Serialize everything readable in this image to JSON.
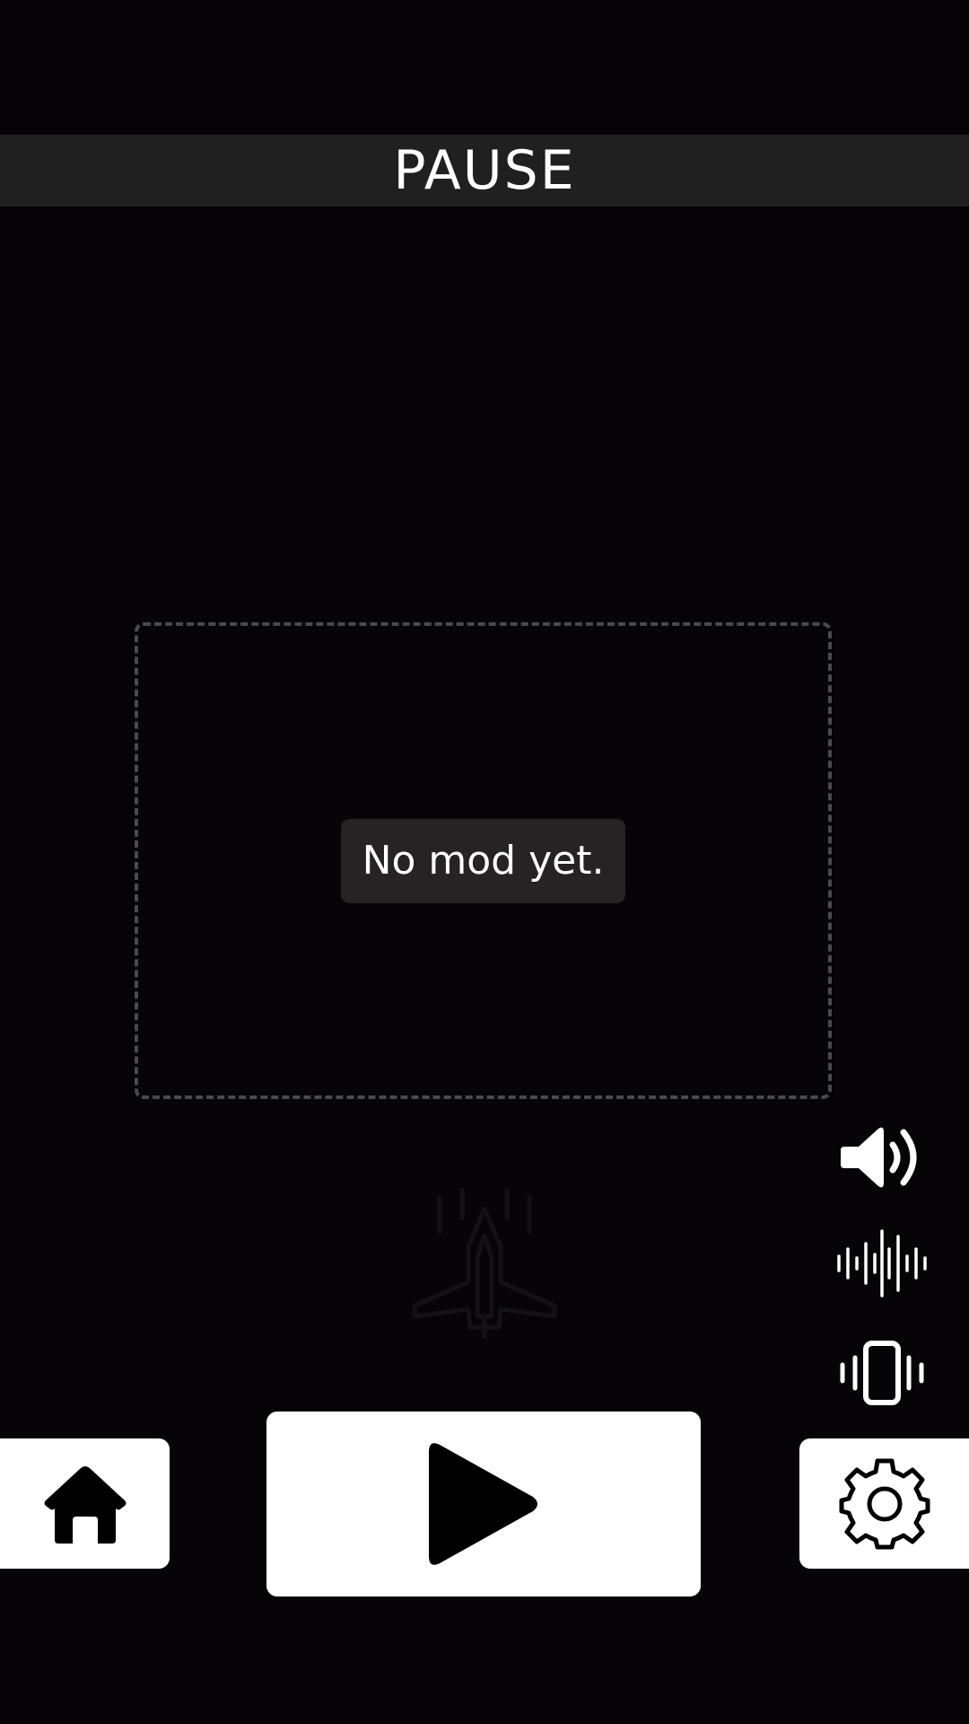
{
  "header": {
    "title": "PAUSE"
  },
  "mod_panel": {
    "empty_message": "No mod yet."
  },
  "side_controls": {
    "icons": [
      "sound-icon",
      "audio-wave-icon",
      "vibration-icon"
    ]
  },
  "bottom_bar": {
    "icons": [
      "home-icon",
      "play-icon",
      "gear-icon"
    ]
  },
  "colors": {
    "background": "#070407",
    "header_bar": "#202020",
    "label_bg": "#272224",
    "dashed_border": "#4a4a4a",
    "button_bg": "#ffffff"
  }
}
